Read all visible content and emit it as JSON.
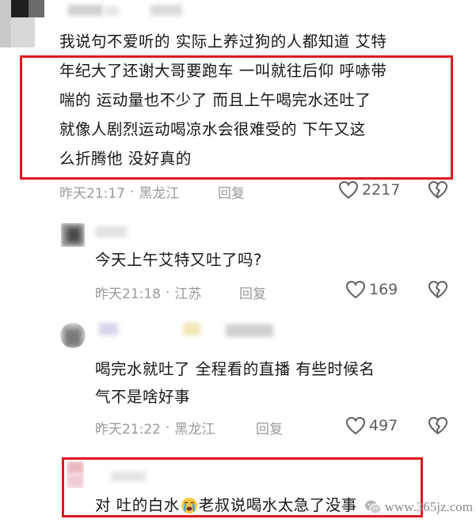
{
  "comments": [
    {
      "lines": [
        "我说句不爱听的 实际上养过狗的人都知道 艾特",
        "年纪大了还谢大哥要跑车 一叫就往后仰 呼哧带",
        "喘的 运动量也不少了  而且上午喝完水还吐了",
        "就像人剧烈运动喝凉水会很难受的   下午又这",
        "么折腾他  没好真的"
      ],
      "time": "昨天21:17",
      "location": "黑龙江",
      "reply_label": "回复",
      "likes": "2217"
    },
    {
      "lines": [
        "今天上午艾特又吐了吗?"
      ],
      "time": "昨天21:18",
      "location": "江苏",
      "reply_label": "回复",
      "likes": "169"
    },
    {
      "lines": [
        "喝完水就吐了 全程看的直播  有些时候名",
        "气不是啥好事"
      ],
      "time": "昨天21:22",
      "location": "黑龙江",
      "reply_label": "回复",
      "likes": "497"
    },
    {
      "lines": [
        "对 吐的白水",
        "老叔说喝水太急了没事"
      ],
      "emoji": "crying-emoji"
    }
  ],
  "watermark": {
    "text": "www.365jz.com",
    "icon": "wechat-logo-icon"
  },
  "colors": {
    "highlight": "#e0161f",
    "meta": "#9a9a9a",
    "text": "#161616"
  }
}
